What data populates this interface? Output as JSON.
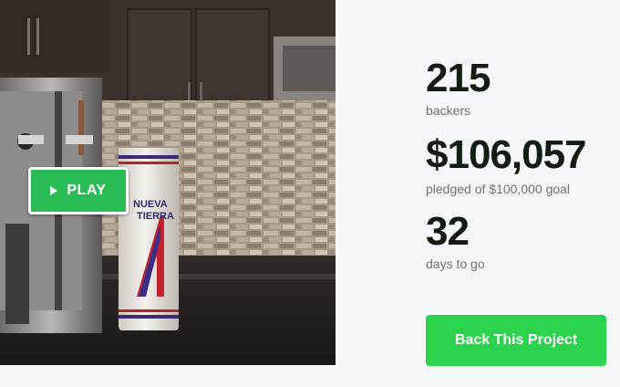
{
  "video": {
    "play_label": "PLAY",
    "can_brand_line1": "NUEVA",
    "can_brand_line2": "TIERRA"
  },
  "stats": {
    "backers_value": "215",
    "backers_label": "backers",
    "pledged_value": "$106,057",
    "pledged_label": "pledged of $100,000 goal",
    "days_value": "32",
    "days_label": "days to go"
  },
  "cta": {
    "back_label": "Back This Project"
  },
  "colors": {
    "accent": "#2bd24c",
    "play_button": "#2bbd55",
    "text_dark": "#111d11",
    "text_muted": "#6b7378",
    "background": "#f4f7f8"
  },
  "icons": {
    "play": "play-icon"
  }
}
